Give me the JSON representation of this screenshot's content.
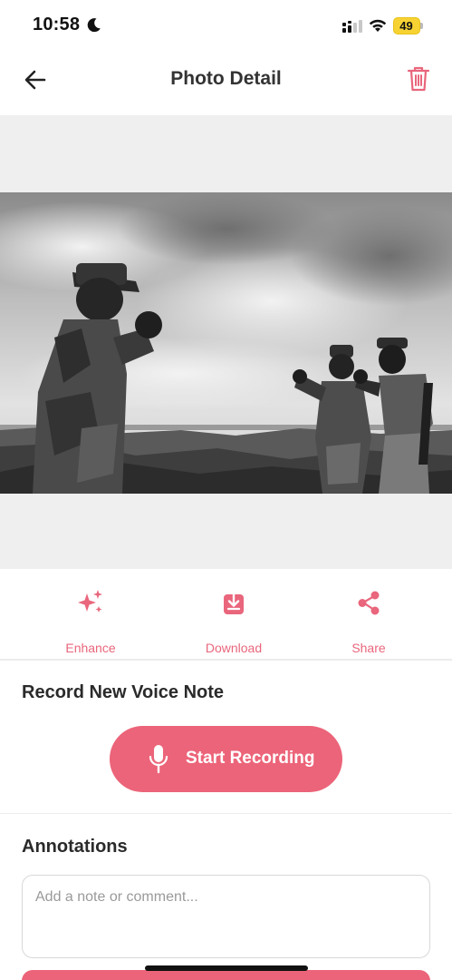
{
  "status_bar": {
    "time": "10:58",
    "battery": "49",
    "icons": [
      "moon-icon",
      "signal-icon",
      "wifi-icon",
      "battery-icon"
    ]
  },
  "header": {
    "title": "Photo Detail",
    "back_icon": "arrow-left-icon",
    "delete_icon": "trash-icon"
  },
  "colors": {
    "accent": "#ec6479",
    "accent_text": "#e9667c",
    "photo_background": "#efefef"
  },
  "actions": [
    {
      "label": "Enhance",
      "icon": "sparkles-icon"
    },
    {
      "label": "Download",
      "icon": "download-icon"
    },
    {
      "label": "Share",
      "icon": "share-icon"
    }
  ],
  "voice_note": {
    "title": "Record New Voice Note",
    "button_label": "Start Recording",
    "button_icon": "microphone-icon"
  },
  "annotations": {
    "title": "Annotations",
    "placeholder": "Add a note or comment...",
    "value": ""
  }
}
